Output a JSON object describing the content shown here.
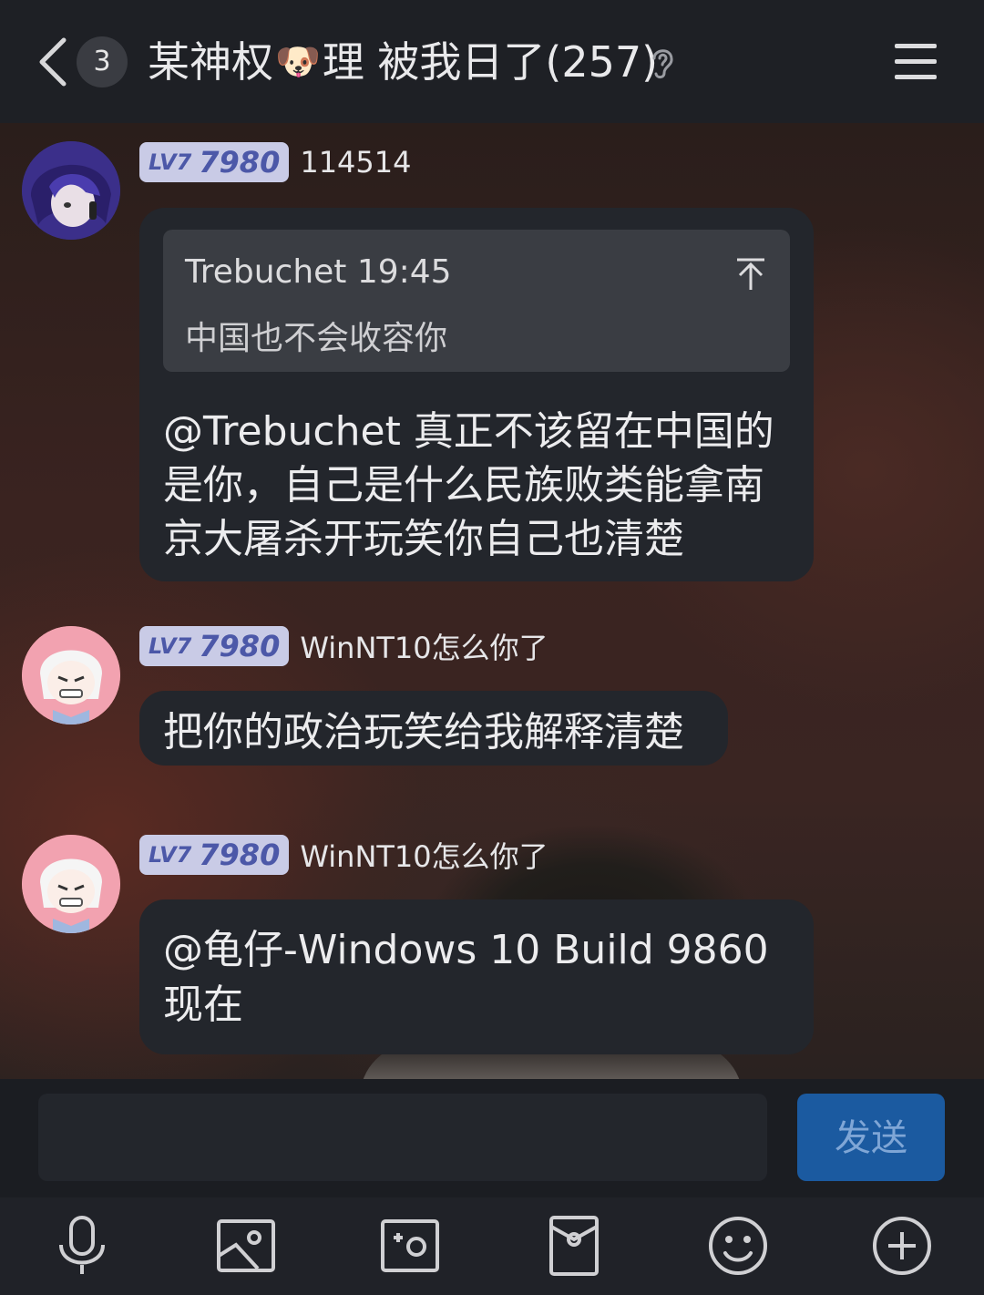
{
  "header": {
    "unread_count": "3",
    "title_prefix": "某神权",
    "title_emoji": "🐶",
    "title_suffix": "理 被我日了(257)"
  },
  "messages": [
    {
      "level": "LV7",
      "points": "7980",
      "nickname": "114514",
      "quote": {
        "author_time": "Trebuchet 19:45",
        "text": "中国也不会收容你"
      },
      "text": "@Trebuchet 真正不该留在中国的是你，自己是什么民族败类能拿南京大屠杀开玩笑你自己也清楚"
    },
    {
      "level": "LV7",
      "points": "7980",
      "nickname": "WinNT10怎么你了",
      "text": "把你的政治玩笑给我解释清楚"
    },
    {
      "level": "LV7",
      "points": "7980",
      "nickname": "WinNT10怎么你了",
      "text": "@龟仔-Windows 10 Build 9860 现在"
    }
  ],
  "input": {
    "placeholder": "",
    "send_label": "发送"
  },
  "toolbar": [
    "microphone-icon",
    "image-icon",
    "camera-icon",
    "red-packet-icon",
    "emoji-icon",
    "plus-icon"
  ]
}
